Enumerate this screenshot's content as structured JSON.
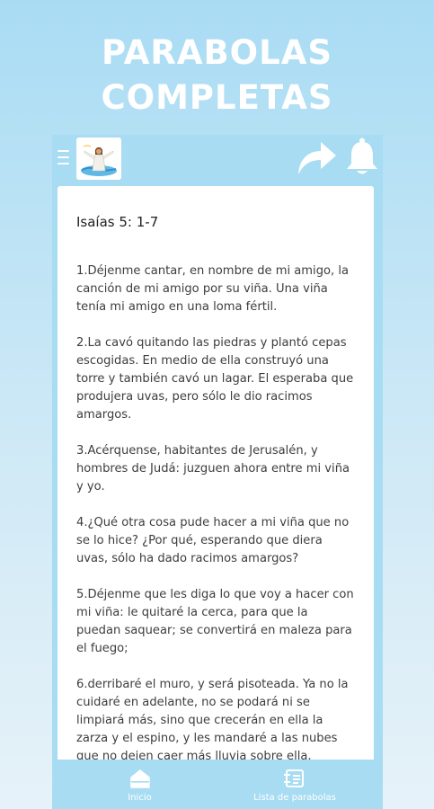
{
  "promo": {
    "title_line1": "PARABOLAS",
    "title_line2": "COMPLETAS"
  },
  "app_bar": {
    "menu_icon": "hamburger-menu-icon",
    "logo_icon": "jesus-figure-logo",
    "share_icon": "share-arrow-icon",
    "bell_icon": "notification-bell-icon"
  },
  "content": {
    "reference": "Isaías 5: 1-7",
    "verses": [
      "1.Déjenme cantar, en nombre de mi amigo, la canción de mi amigo por su viña. Una viña tenía mi amigo en una loma fértil.",
      "2.La cavó quitando las piedras y plantó cepas escogidas. En medio de ella construyó una torre y también cavó un lagar. El esperaba que produjera uvas, pero sólo le dio racimos amargos.",
      "3.Acérquense, habitantes de Jerusalén, y hombres de Judá: juzguen ahora entre mi viña y yo.",
      "4.¿Qué otra cosa pude hacer a mi viña que no se lo hice? ¿Por qué, esperando que diera uvas, sólo ha dado racimos amargos?",
      "5.Déjenme que les diga lo que voy a hacer con mi viña: le quitaré la cerca, para que la puedan saquear; se convertirá en maleza para el fuego;",
      "6.derribaré el muro, y será pisoteada. Ya no la cuidaré en adelante, no se podará ni se limpiará más, sino que crecerán en ella la zarza y el espino, y les mandaré a las nubes que no dejen caer más lluvia sobre ella."
    ]
  },
  "bottom_nav": {
    "home_label": "Inicio",
    "home_icon": "house-icon",
    "list_label": "Lista de parabolas",
    "list_icon": "list-icon"
  },
  "colors": {
    "app_bar": "#a7dcf2",
    "background_top": "#a9dcf4",
    "text": "#3d3d3d"
  }
}
